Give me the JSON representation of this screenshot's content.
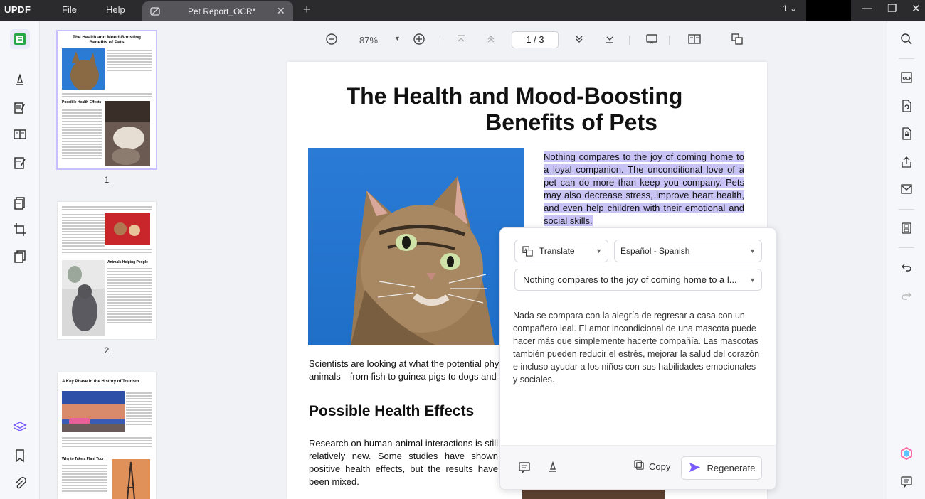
{
  "titlebar": {
    "logo": "UPDF",
    "menu": [
      "File",
      "Help"
    ],
    "tab_title": "Pet Report_OCR*",
    "window_count": "1"
  },
  "doc_toolbar": {
    "zoom": "87%",
    "page_current": "1",
    "page_total": "3",
    "page_display": "1 / 3"
  },
  "thumbnails": [
    {
      "num": "1",
      "title": "The Health and Mood-Boosting Benefits of Pets",
      "subheading": "Possible Health Effects"
    },
    {
      "num": "2",
      "subheading": "Animals Helping People"
    },
    {
      "title": "A Key Phase in the History of Tourism",
      "subheading": "Why to Take a Plant Tour"
    }
  ],
  "document": {
    "title_line1": "The Health and Mood-Boosting",
    "title_line2": "Benefits of Pets",
    "selected_paragraph": "Nothing compares to the joy of coming home to a loyal companion. The unconditional love of a pet can do more than keep you company. Pets may also decrease stress, improve heart health, and even help children with their emotional and social skills.",
    "body1": "Scientists are looking at what the potential physi\nanimals—from fish to guinea pigs to dogs and ca",
    "heading2": "Possible Health Effects",
    "body2": "Research on human-animal interactions is still relatively new. Some studies have shown positive health effects, but the results have been mixed."
  },
  "translate_popup": {
    "mode": "Translate",
    "language": "Español - Spanish",
    "source_preview": "Nothing compares to the joy of coming home to a l...",
    "translation": "Nada se compara con la alegría de regresar a casa con un compañero leal. El amor incondicional de una mascota puede hacer más que simplemente hacerte compañía. Las mascotas también pueden reducir el estrés, mejorar la salud del corazón e incluso ayudar a los niños con sus habilidades emocionales y sociales.",
    "copy_label": "Copy",
    "regenerate_label": "Regenerate"
  },
  "colors": {
    "accent": "#7a5cff",
    "selection": "#c7c3f5",
    "titlebar_bg": "#2b2b2e"
  }
}
